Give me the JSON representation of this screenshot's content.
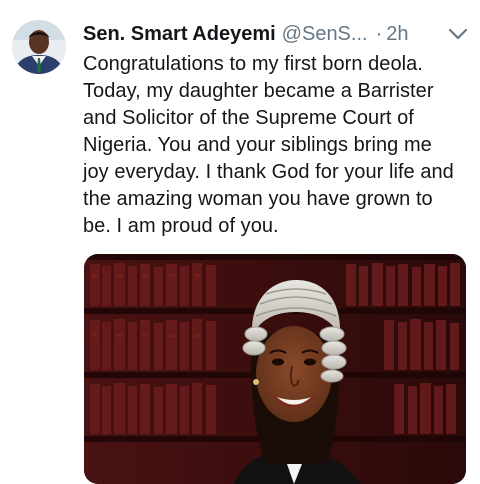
{
  "tweet": {
    "author_name": "Sen. Smart Adeyemi",
    "author_handle": "@SenS...",
    "separator": "·",
    "timestamp": "2h",
    "menu_icon": "chevron-down-icon",
    "avatar_icon": "profile-photo",
    "text_lines": [
      "Congratulations to my first born deola.",
      "Today, my daughter became a Barrister",
      "and Solicitor of the Supreme Court of",
      "Nigeria. You and your siblings bring me",
      "joy everyday. I thank God for your life and",
      "the amazing woman you have grown to",
      "be. I am proud of you."
    ],
    "media_description_icon": "photo-barrister-in-wig"
  },
  "colors": {
    "text_primary": "#14171a",
    "text_secondary": "#657786",
    "background": "#ffffff"
  }
}
